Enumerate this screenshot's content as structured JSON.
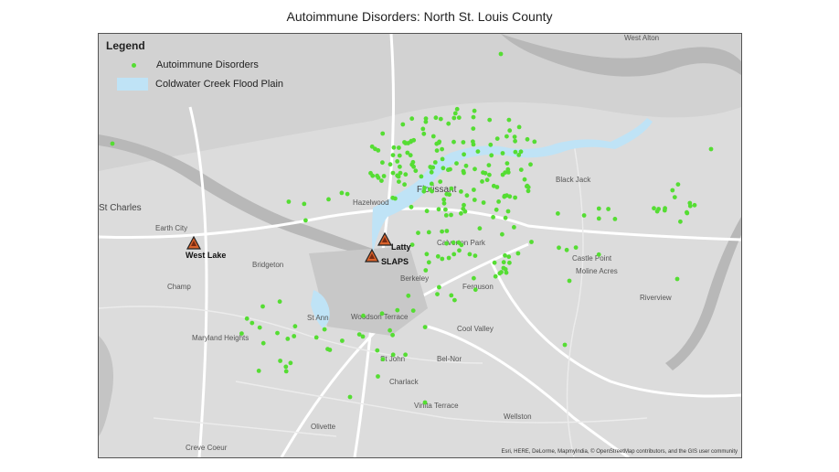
{
  "title": "Autoimmune Disorders:  North St. Louis County",
  "legend": {
    "heading": "Legend",
    "items": [
      {
        "label": "Autoimmune Disorders",
        "symbol": "green-dot-icon",
        "color": "#55dd33"
      },
      {
        "label": "Coldwater Creek Flood Plain",
        "symbol": "flood-plain-swatch",
        "color": "#bfe3f6"
      }
    ]
  },
  "sites": [
    {
      "name": "West Lake"
    },
    {
      "name": "Latty"
    },
    {
      "name": "SLAPS"
    }
  ],
  "places": [
    "West Alton",
    "St Charles",
    "Hazelwood",
    "Florissant",
    "Black Jack",
    "Earth City",
    "Bridgeton",
    "Calverton Park",
    "Castle Point",
    "Moline Acres",
    "Champ",
    "Berkeley",
    "Ferguson",
    "Riverview",
    "St Ann",
    "Woodson Terrace",
    "Cool Valley",
    "Maryland Heights",
    "St John",
    "Bel-Nor",
    "Charlack",
    "Vinita Terrace",
    "Wellston",
    "Olivette",
    "Creve Coeur"
  ],
  "attribution": "Esri, HERE, DeLorme, MapmyIndia, © OpenStreetMap contributors, and the GIS user community",
  "colors": {
    "point": "#55dd33",
    "flood_plain": "#bfe3f6",
    "site_marker": "#d9622b",
    "river": "#b8b8b8",
    "land": "#d2d2d2",
    "road": "#ffffff"
  }
}
